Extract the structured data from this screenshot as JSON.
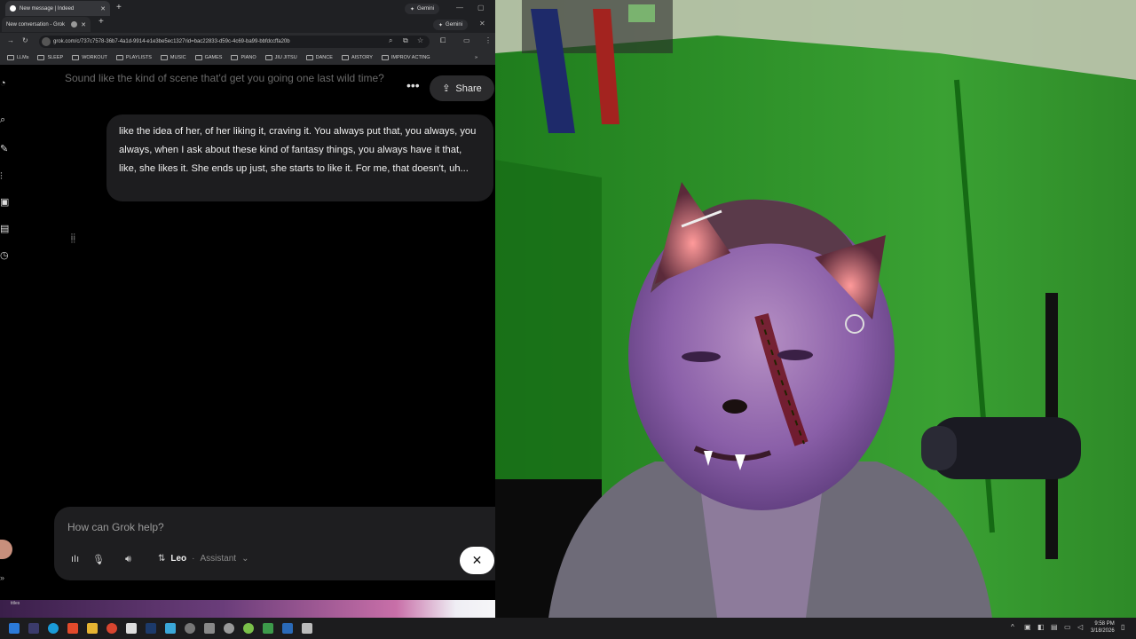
{
  "browser": {
    "tabs_top": [
      {
        "label": "New message | Indeed",
        "icon": "indeed-icon"
      },
      {
        "label": "Gemini",
        "icon": "gemini-icon"
      }
    ],
    "tabs_bottom": [
      {
        "label": "New conversation - Grok",
        "icon": "grok-icon"
      },
      {
        "label": "Gemini",
        "icon": "gemini-icon"
      }
    ],
    "url": "grok.com/c/737c7578-36b7-4a1d-9914-e1e3be5ec1327rid=bac22833-d59c-4c69-ba99-bbfdccffa20b",
    "bookmarks": [
      "LLMs",
      "SLEEP",
      "WORKOUT",
      "PLAYLISTS",
      "MUSIC",
      "GAMES",
      "PIANO",
      "JIU JITSU",
      "DANCE",
      "AISTORY",
      "IMPROV ACTING"
    ]
  },
  "chat": {
    "previous_line": "Sound like the kind of scene that'd get you going one last wild time?",
    "share_label": "Share",
    "user_message": "like the idea of her, of her liking it, craving it. You always put that, you always, you always, when I ask about these kind of fantasy things, you always have it that, like, she likes it. She ends up just, she starts to like it. For me, that doesn't, uh...",
    "composer_placeholder": "How can Grok help?",
    "persona_name": "Leo",
    "persona_separator": "·",
    "persona_role": "Assistant",
    "close_glyph": "✕",
    "glow_label": "titles"
  },
  "taskbar": {
    "time": "9:58 PM",
    "date": "3/18/2026"
  },
  "colors": {
    "chat_bg": "#000000",
    "bubble_bg": "#1d1d1f",
    "green_screen": "#1e7a1c",
    "taskbar": "#1c1c1e"
  }
}
